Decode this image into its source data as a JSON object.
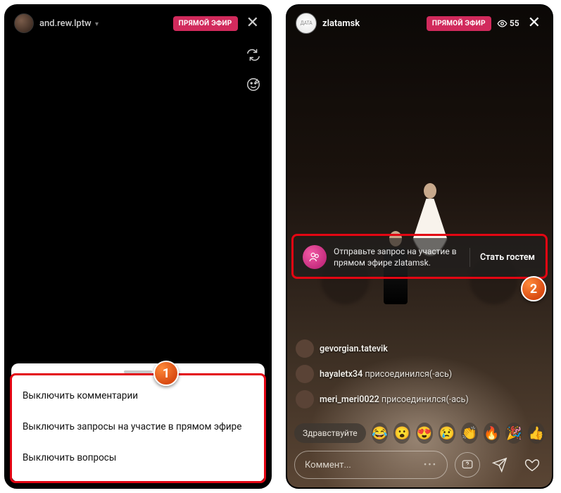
{
  "left": {
    "username": "and.rew.lptw",
    "live_badge": "ПРЯМОЙ ЭФИР",
    "sheet": {
      "opt1": "Выключить комментарии",
      "opt2": "Выключить запросы на участие в прямом эфире",
      "opt3": "Выключить вопросы"
    },
    "marker": "1"
  },
  "right": {
    "host_username": "zlatamsk",
    "host_avatar_label": "ДАТА",
    "live_badge": "ПРЯМОЙ ЭФИР",
    "viewer_count": "55",
    "guest_banner": {
      "text": "Отправьте запрос на участие в прямом эфире zlatamsk.",
      "button": "Стать гостем"
    },
    "comments": [
      {
        "user": "gevorgian.tatevik",
        "text": ""
      },
      {
        "user": "hayaletx34",
        "text": "присоединился(-ась)"
      },
      {
        "user": "meri_meri0022",
        "text": "присоединился(-ась)"
      }
    ],
    "quickreply": "Здравствуйте",
    "composer_placeholder": "Коммент...",
    "marker": "2"
  }
}
